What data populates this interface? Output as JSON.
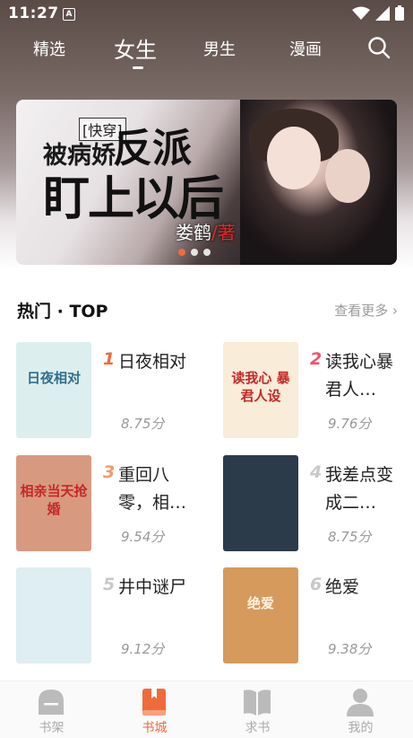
{
  "status": {
    "time": "11:27",
    "notif_letter": "A"
  },
  "tabs": [
    {
      "label": "精选",
      "active": false
    },
    {
      "label": "女生",
      "active": true
    },
    {
      "label": "男生",
      "active": false
    },
    {
      "label": "漫画",
      "active": false
    }
  ],
  "banner": {
    "tag": "[快穿]",
    "title_part1": "被病娇",
    "title_part2": "反派",
    "title_part3": "盯上以后",
    "author": "娄鹤",
    "author_suffix": "/著",
    "slide_count": 3,
    "active_slide": 1
  },
  "section": {
    "title": "热门 · TOP",
    "more": "查看更多 ›"
  },
  "books": [
    {
      "rank": "1",
      "name": "日夜相对",
      "score": "8.75分",
      "rank_color": "#f06b3b",
      "cover_text": "日夜相对",
      "cover_bg": "#dcefee"
    },
    {
      "rank": "2",
      "name": "读我心暴君人…",
      "score": "9.76分",
      "rank_color": "#e8576b",
      "cover_text": "读我心 暴君人设",
      "cover_bg": "#f9ecd8"
    },
    {
      "rank": "3",
      "name": "重回八零，相…",
      "score": "9.54分",
      "rank_color": "#f39a72",
      "cover_text": "相亲当天抢婚",
      "cover_bg": "#d79a80"
    },
    {
      "rank": "4",
      "name": "我差点变成二…",
      "score": "8.75分",
      "rank_color": "#c8c8c8",
      "cover_text": "",
      "cover_bg": "#2b3b4a"
    },
    {
      "rank": "5",
      "name": "井中谜尸",
      "score": "9.12分",
      "rank_color": "#c8c8c8",
      "cover_text": "",
      "cover_bg": "#dfeef3"
    },
    {
      "rank": "6",
      "name": "绝爱",
      "score": "9.38分",
      "rank_color": "#c8c8c8",
      "cover_text": "绝爱",
      "cover_bg": "#d69a5c"
    }
  ],
  "tabbar": [
    {
      "label": "书架",
      "icon": "bookshelf-icon",
      "active": false
    },
    {
      "label": "书城",
      "icon": "bookstore-icon",
      "active": true
    },
    {
      "label": "求书",
      "icon": "open-book-icon",
      "active": false
    },
    {
      "label": "我的",
      "icon": "user-icon",
      "active": false
    }
  ],
  "colors": {
    "accent": "#f06b3b"
  }
}
